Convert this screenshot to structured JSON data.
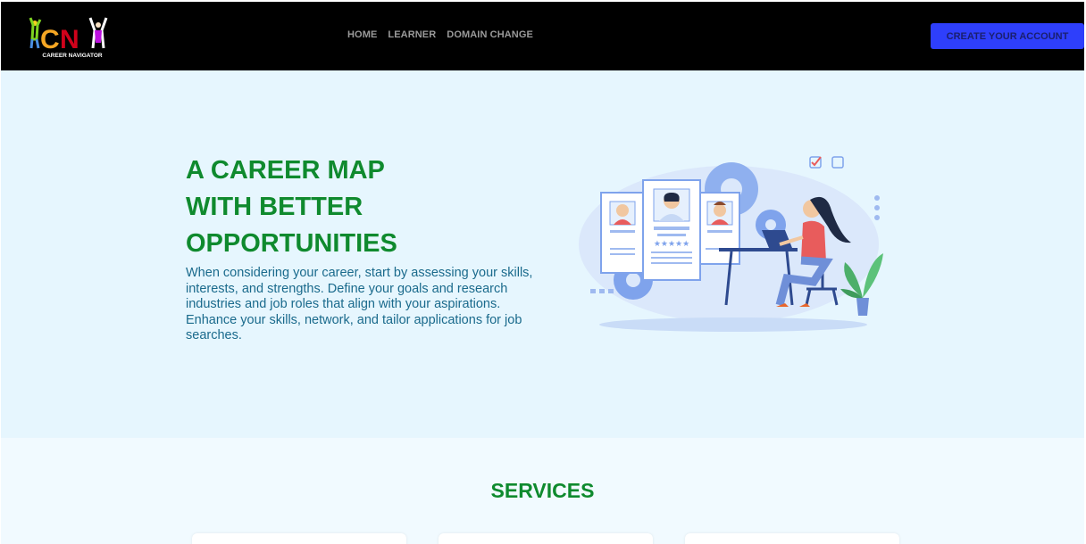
{
  "header": {
    "logo_text": "CAREER NAVIGATOR",
    "logo_letters": "CNY",
    "nav": [
      {
        "label": "HOME"
      },
      {
        "label": "LEARNER"
      },
      {
        "label": "DOMAIN CHANGE"
      }
    ],
    "cta_label": "CREATE YOUR ACCOUNT"
  },
  "hero": {
    "title_lines": [
      "A CAREER MAP",
      "WITH BETTER",
      "OPPORTUNITIES"
    ],
    "description": "When considering your career, start by assessing your skills, interests, and strengths. Define your goals and research industries and job roles that align with your aspirations. Enhance your skills, network, and tailor applications for job searches.",
    "illustration": "career-profiles-illustration"
  },
  "services": {
    "title": "SERVICES",
    "cards": [
      {},
      {},
      {}
    ]
  },
  "colors": {
    "nav_bg": "#000000",
    "accent_button": "#2e3ffb",
    "heading_green": "#0f8a2e",
    "body_text": "#1a6a8c",
    "hero_bg": "#e6f6fe",
    "services_bg": "#f1faff"
  }
}
